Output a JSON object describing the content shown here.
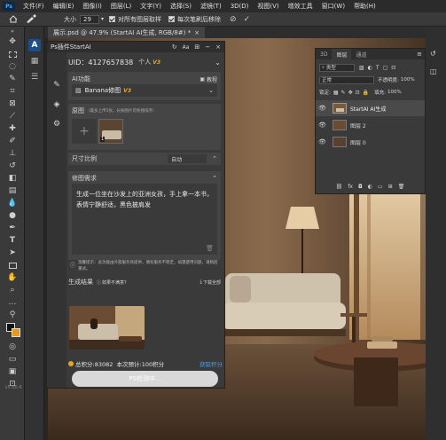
{
  "menu": {
    "items": [
      "文件(F)",
      "编辑(E)",
      "图像(I)",
      "图层(L)",
      "文字(Y)",
      "选择(S)",
      "滤镜(T)",
      "3D(D)",
      "视图(V)",
      "增效工具",
      "窗口(W)",
      "帮助(H)"
    ]
  },
  "options": {
    "size_label": "大小",
    "size_value": "29",
    "sample_all_label": "对所有图层取样",
    "resample_label": "每次笔刷后移除"
  },
  "document": {
    "tab_title": "展示.psd @ 47.9% (StartAI AI生成, RGB/8#) *"
  },
  "toolbox": {
    "version": "v5.10.4"
  },
  "plugin": {
    "title": "Ps插件StartAI",
    "uid": "UID：4127657838",
    "account_label": "个人",
    "account_badge": "V3",
    "ai_section": "AI功能",
    "tutorial": "教程",
    "model_name": "Banana修图",
    "model_badge": "V3",
    "source_label": "原图",
    "source_hint": "（最多上传5张，长按图片可拖拽排序）",
    "source_thumb_index": "1",
    "ratio_label": "尺寸比例",
    "ratio_value": "自动",
    "prompt_label": "修图需求",
    "prompt_text": "生成一位坐在沙发上的亚洲女孩，手上拿一本书，表情宁静舒适，黑色披肩发",
    "notice": "温馨提示：此功能由外部服务商提供，偶有服务不稳定，如遇使用问题，请稍后重试。",
    "result_label": "生成结果",
    "result_feedback": "效果不满意?",
    "download_all": "下载全部",
    "points_text": "总积分:83082  本次预计:100积分",
    "get_points": "获取积分",
    "action_button": "PS检测中..."
  },
  "layers_panel": {
    "tabs": [
      "3D",
      "图层",
      "通道"
    ],
    "filter_label": "类型",
    "blend_mode": "正常",
    "opacity_label": "不透明度:",
    "opacity_value": "100%",
    "lock_label": "锁定:",
    "fill_label": "填充:",
    "fill_value": "100%",
    "layers": [
      {
        "name": "StartAI AI生成",
        "selected": true
      },
      {
        "name": "图层 2",
        "selected": false
      },
      {
        "name": "图层 0",
        "selected": false
      }
    ]
  },
  "colors": {
    "accent": "#2f7fd6",
    "badge": "#e8a524",
    "panel": "#3a3a3a",
    "section": "#454545"
  }
}
